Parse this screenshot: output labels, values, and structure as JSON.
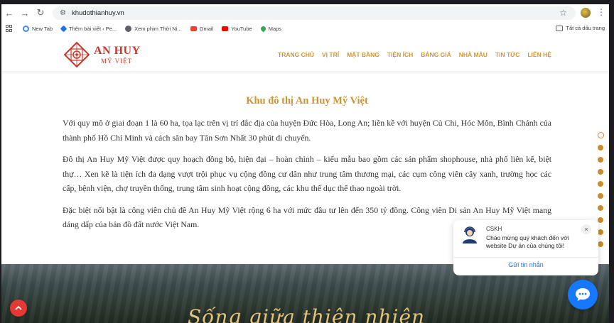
{
  "browser": {
    "url": "khudothianhuy.vn",
    "bookmarks": [
      {
        "label": "New Tab",
        "color": "#4285f4"
      },
      {
        "label": "Thêm bài viết ‹ Pe...",
        "color": "#1a73e8"
      },
      {
        "label": "Xem phim Thời Ni...",
        "color": "#5f6368"
      },
      {
        "label": "Gmail",
        "color": "#ea4335"
      },
      {
        "label": "YouTube",
        "color": "#ff0000"
      },
      {
        "label": "Maps",
        "color": "#34a853"
      }
    ],
    "all_bookmarks_label": "Tất cả dấu trang"
  },
  "site": {
    "logo": {
      "line1": "AN HUY",
      "line2": "MỸ VIỆT"
    },
    "nav": [
      "TRANG CHỦ",
      "VỊ TRÍ",
      "MẶT BẰNG",
      "TIỆN ÍCH",
      "BẢNG GIÁ",
      "NHÀ MẪU",
      "TIN TỨC",
      "LIÊN HỆ"
    ],
    "title": "Khu đô thị An Huy Mỹ Việt",
    "paragraphs": [
      "Với quy mô ở giai đoạn 1 là 60 ha, tọa lạc trên vị trí đắc địa của huyện Đức Hòa, Long An; liền kề với huyện Củ Chi, Hóc Môn, Bình Chánh của thành phố Hồ Chí Minh và cách sân bay Tân Sơn Nhất 30 phút di chuyển.",
      "Đô thị An Huy Mỹ Việt được quy hoạch đồng bộ, hiện đại – hoàn chỉnh – kiểu mẫu bao gồm các sản phẩm shophouse, nhà phố liên kế, biệt thự… Xen kẽ là tiện ích đa dạng vượt trội phục vụ cộng đồng cư dân như trung tâm thương mại, các cụm công viên cây xanh, trường học các cấp, bệnh viện, chợ truyền thống, trung tâm sinh hoạt cộng đồng, các khu thể dục thể thao ngoài trời.",
      "Đặc biệt nổi bật là công viên chủ đề An Huy Mỹ Việt rộng 6 ha với mức đầu tư lên đến 350 tỷ đồng. Công viên Di sản An Huy Mỹ Việt mang dáng dấp của bản đồ đất nước Việt Nam."
    ],
    "banner_script": "Sống giữa thiên nhiên",
    "colors": {
      "gold": "#c9962f",
      "brand_red": "#c8372b",
      "chat_blue": "#1677ff"
    }
  },
  "chat": {
    "agent": "CSKH",
    "message": "Chào mừng quý khách đến với website Dự án của chúng tôi!",
    "send_label": "Gửi tin nhắn",
    "close": "×"
  }
}
